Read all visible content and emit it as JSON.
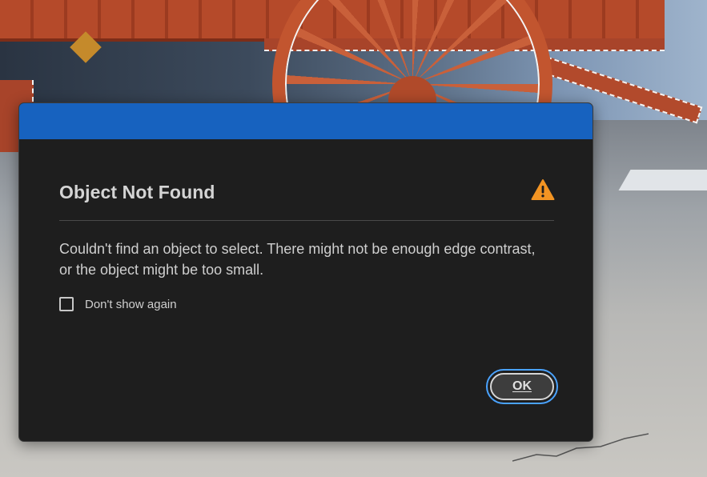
{
  "dialog": {
    "title": "Object Not Found",
    "message": "Couldn't find an object to select. There might not be enough edge contrast, or the object might be too small.",
    "checkbox_label": "Don't show again",
    "checkbox_checked": false,
    "ok_label": "OK",
    "warning_icon": "warning-triangle",
    "colors": {
      "titlebar": "#1762bf",
      "background": "#1e1e1e",
      "warning": "#f29423",
      "focus_ring": "#4aa3ff"
    }
  }
}
